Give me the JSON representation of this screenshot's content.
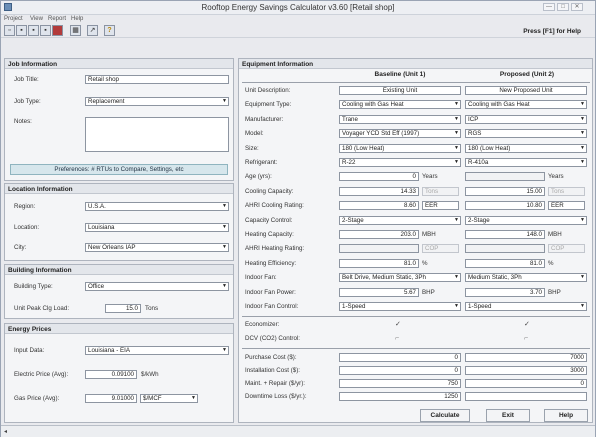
{
  "window": {
    "title": "Rooftop Energy Savings Calculator v3.60 [Retail shop]",
    "min": "—",
    "max": "□",
    "close": "✕"
  },
  "menu": [
    "Project",
    "View",
    "Report",
    "Help"
  ],
  "toolbar": {
    "help_hint": "Press [F1] for Help"
  },
  "job": {
    "header": "Job Information",
    "title_label": "Job Title:",
    "title_value": "Retail shop",
    "type_label": "Job Type:",
    "type_value": "Replacement",
    "notes_label": "Notes:",
    "notes_value": "",
    "prefs_button": "Preferences: # RTUs to Compare, Settings, etc"
  },
  "location": {
    "header": "Location Information",
    "region_label": "Region:",
    "region_value": "U.S.A.",
    "location_label": "Location:",
    "location_value": "Louisiana",
    "city_label": "City:",
    "city_value": "New Orleans IAP"
  },
  "building": {
    "header": "Building Information",
    "type_label": "Building Type:",
    "type_value": "Office",
    "load_label": "Unit Peak Clg Load:",
    "load_value": "15.0",
    "load_unit": "Tons"
  },
  "energy": {
    "header": "Energy Prices",
    "input_label": "Input Data:",
    "input_value": "Louisiana - EIA",
    "elec_label": "Electric Price (Avg):",
    "elec_value": "0.09100",
    "elec_unit": "$/kWh",
    "gas_label": "Gas Price (Avg):",
    "gas_value": "9.01000",
    "gas_unit": "$/MCF"
  },
  "equipment": {
    "header": "Equipment Information",
    "col_baseline": "Baseline (Unit 1)",
    "col_proposed": "Proposed (Unit 2)",
    "rows": [
      {
        "label": "Unit Description:",
        "baseline": "Existing Unit",
        "proposed": "New Proposed Unit"
      },
      {
        "label": "Equipment Type:",
        "baseline": "Cooling with Gas Heat",
        "proposed": "Cooling with Gas Heat"
      },
      {
        "label": "Manufacturer:",
        "baseline": "Trane",
        "proposed": "ICP"
      },
      {
        "label": "Model:",
        "baseline": "Voyager YCD Std Eff (1997)",
        "proposed": "RGS"
      },
      {
        "label": "Size:",
        "baseline": "180 (Low Heat)",
        "proposed": "180 (Low Heat)"
      },
      {
        "label": "Refrigerant:",
        "baseline": "R-22",
        "proposed": "R-410a"
      },
      {
        "label": "Age (yrs):",
        "baseline": "0",
        "baseline_unit": "Years",
        "proposed": "",
        "proposed_unit": "Years"
      },
      {
        "label": "Cooling Capacity:",
        "baseline": "14.33",
        "baseline_unit": "Tons",
        "proposed": "15.00",
        "proposed_unit": "Tons"
      },
      {
        "label": "AHRI Cooling Rating:",
        "baseline": "8.60",
        "baseline_unit": "EER",
        "proposed": "10.80",
        "proposed_unit": "EER"
      },
      {
        "label": "Capacity Control:",
        "baseline": "2-Stage",
        "proposed": "2-Stage"
      },
      {
        "label": "Heating Capacity:",
        "baseline": "203.0",
        "baseline_unit": "MBH",
        "proposed": "148.0",
        "proposed_unit": "MBH"
      },
      {
        "label": "AHRI Heating Rating:",
        "baseline": "",
        "baseline_unit": "COP",
        "proposed": "",
        "proposed_unit": "COP"
      },
      {
        "label": "Heating Efficiency:",
        "baseline": "81.0",
        "baseline_unit": "%",
        "proposed": "81.0",
        "proposed_unit": "%"
      },
      {
        "label": "Indoor Fan:",
        "baseline": "Belt Drive, Medium Static, 3Ph",
        "proposed": "Medium Static, 3Ph"
      },
      {
        "label": "Indoor Fan Power:",
        "baseline": "5.67",
        "baseline_unit": "BHP",
        "proposed": "3.70",
        "proposed_unit": "BHP"
      },
      {
        "label": "Indoor Fan Control:",
        "baseline": "1-Speed",
        "proposed": "1-Speed"
      }
    ],
    "economizer_label": "Economizer:",
    "economizer": {
      "baseline": true,
      "proposed": true
    },
    "dcv_label": "DCV (CO2) Control:",
    "dcv": {
      "baseline": false,
      "proposed": false
    },
    "costs": [
      {
        "label": "Purchase Cost ($):",
        "baseline": "0",
        "proposed": "7000"
      },
      {
        "label": "Installation Cost ($):",
        "baseline": "0",
        "proposed": "3000"
      },
      {
        "label": "Maint. + Repair ($/yr):",
        "baseline": "750",
        "proposed": "0"
      },
      {
        "label": "Downtime Loss ($/yr.):",
        "baseline": "1250",
        "proposed": ""
      }
    ]
  },
  "buttons": {
    "calculate": "Calculate",
    "exit": "Exit",
    "help": "Help"
  },
  "checkmark": "✓",
  "uncheck": "⌐"
}
